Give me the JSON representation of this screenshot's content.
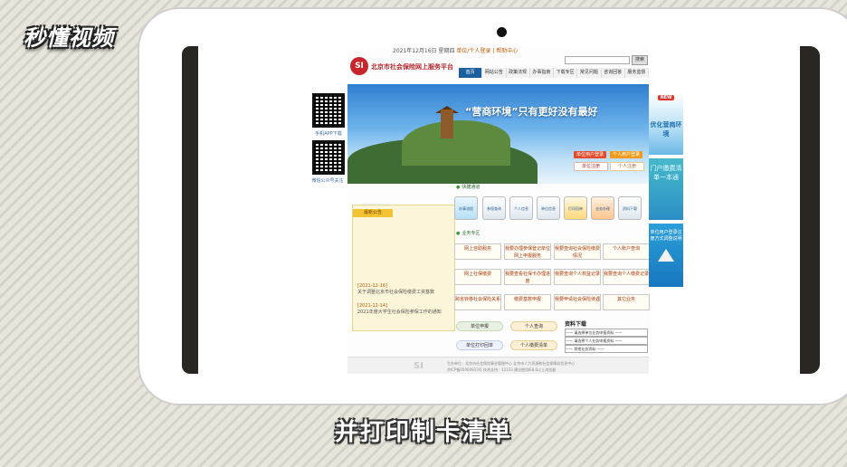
{
  "watermark": {
    "logo_text": "秒懂视频"
  },
  "site": {
    "brand_mark": "SI",
    "title": "北京市社会保险网上服务平台",
    "top_links_text": "2021年12月16日 星期四",
    "top_links_highlight": "单位/个人登录  |  帮助中心",
    "search_button": "搜索",
    "nav": [
      "首页",
      "网站公告",
      "政策法规",
      "办事指南",
      "下载专区",
      "常见问题",
      "咨询回答",
      "服务监督"
    ],
    "banner": {
      "slogan": "“营商环境”只有更好没有最好",
      "login_unit": "单位用户登录",
      "login_personal": "个人用户登录",
      "login_unit_sub": "单位注册",
      "login_personal_sub": "个人注册"
    },
    "qr": {
      "label_top": "手机APP下载",
      "label_bottom": "微信公众号关注"
    },
    "notice": {
      "head": "最新公告",
      "items": [
        {
          "date": "[2021-12-16]",
          "text": "关于调整北京市社会保险缴费工资基数"
        },
        {
          "date": "[2021-12-14]",
          "text": "2021年度大学生社会保险参保工作的通知"
        }
      ]
    },
    "section1": "快捷通道",
    "tiles": [
      "办事流程",
      "参保查询",
      "个人信息",
      "单位信息",
      "打印回单",
      "业务办理",
      "资料下载"
    ],
    "section2": "业务专区",
    "services": [
      "网上自助服务",
      "我要办理参保登记单位网上申报服务",
      "我要查询社会保险缴费情况",
      "个人账户查询",
      "网上社保缴费",
      "我要查看社保卡办理进度",
      "我要查询个人权益记录",
      "我要查询个人缴费记录",
      "跨省转移社会保险关系",
      "缴费基数申报",
      "我要申请社会保险待遇",
      "其它业务"
    ],
    "pills": [
      "单位申报",
      "个人查询",
      "单位打印回单",
      "个人缴费清单"
    ],
    "downloads": {
      "title": "资料下载",
      "options": [
        "—— 请选择单位业务申报资料 ——",
        "—— 请选择个人业务申报资料 ——",
        "—— 其他业务资料 ——"
      ]
    },
    "footer": {
      "logo": "SI",
      "line1": "主办单位：北京市社会保险事业管理中心  北京市人力资源和社会保障局信息中心",
      "line2": "京ICP备05060933号  技术支持：12333  建议使用IE8.0以上浏览器"
    },
    "ads": {
      "top_tag": "NEW",
      "top_text": "优化营商环境",
      "middle_text": "门户缴费清单一本通",
      "bottom_text": "单位用户登录注册方式调整说明"
    }
  },
  "caption": "并打印制卡清单"
}
